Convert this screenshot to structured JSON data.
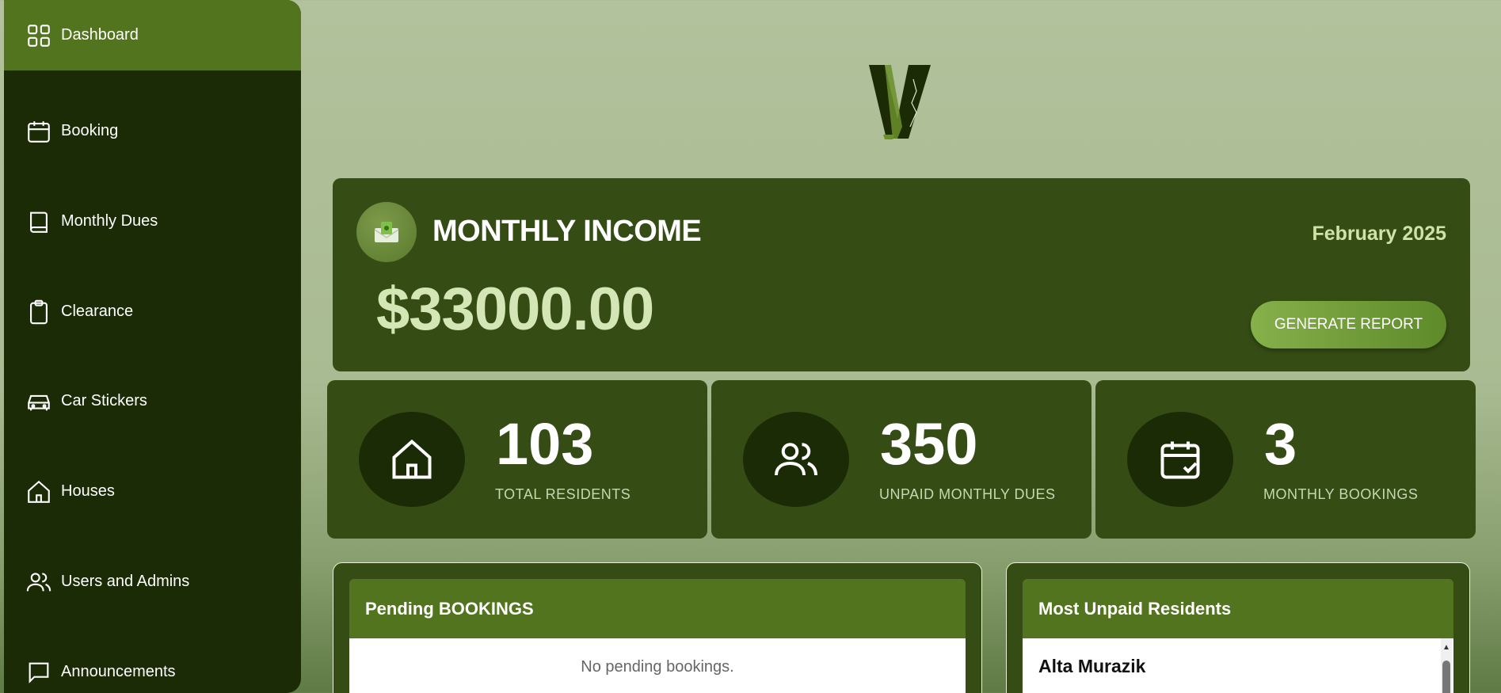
{
  "sidebar": {
    "items": [
      {
        "label": "Dashboard",
        "icon": "dashboard-grid-icon",
        "active": true
      },
      {
        "label": "Booking",
        "icon": "calendar-icon"
      },
      {
        "label": "Monthly Dues",
        "icon": "book-icon"
      },
      {
        "label": "Clearance",
        "icon": "clipboard-icon"
      },
      {
        "label": "Car Stickers",
        "icon": "car-icon"
      },
      {
        "label": "Houses",
        "icon": "house-icon"
      },
      {
        "label": "Users and Admins",
        "icon": "users-icon"
      },
      {
        "label": "Announcements",
        "icon": "message-icon"
      }
    ]
  },
  "income": {
    "title": "MONTHLY INCOME",
    "date": "February 2025",
    "amount": "$33000.00",
    "button_label": "GENERATE REPORT"
  },
  "stats": [
    {
      "value": "103",
      "caption": "TOTAL RESIDENTS",
      "icon": "house-icon"
    },
    {
      "value": "350",
      "caption": "UNPAID MONTHLY DUES",
      "icon": "users-icon"
    },
    {
      "value": "3",
      "caption": "MONTHLY BOOKINGS",
      "icon": "calendar-check-icon"
    }
  ],
  "pending_bookings": {
    "title": "Pending BOOKINGS",
    "empty_message": "No pending bookings."
  },
  "unpaid_residents": {
    "title": "Most Unpaid Residents",
    "rows": [
      "Alta Murazik"
    ]
  },
  "colors": {
    "sidebar_bg": "#1b2b05",
    "active_item": "#52741f",
    "card_bg": "#354d14",
    "accent_text": "#d4e6b5"
  }
}
